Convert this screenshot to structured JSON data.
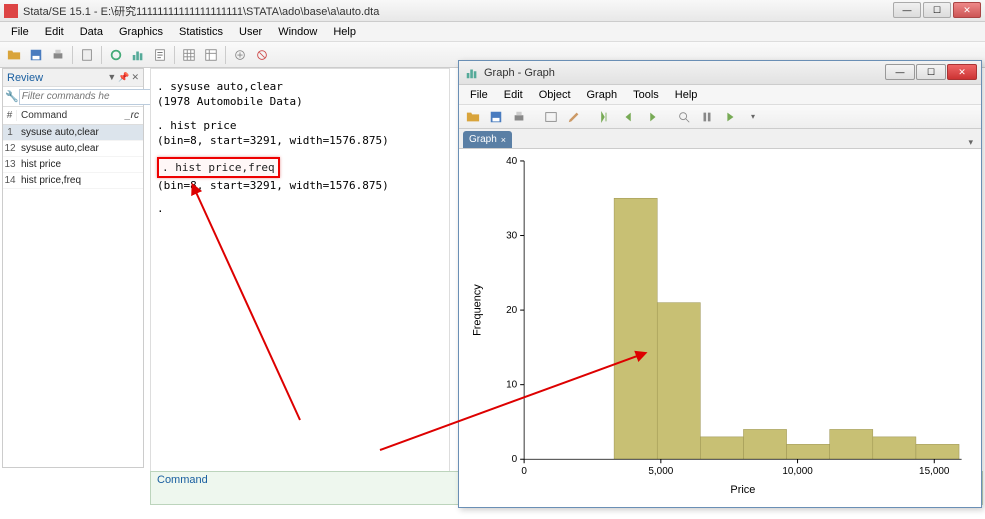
{
  "window": {
    "title": "Stata/SE 15.1 - E:\\研究11111111111111111111\\STATA\\ado\\base\\a\\auto.dta"
  },
  "menu": {
    "items": [
      "File",
      "Edit",
      "Data",
      "Graphics",
      "Statistics",
      "User",
      "Window",
      "Help"
    ]
  },
  "review": {
    "title": "Review",
    "filter_placeholder": "Filter commands he",
    "col_num": "#",
    "col_cmd": "Command",
    "col_rc": "_rc",
    "rows": [
      {
        "n": "1",
        "cmd": "sysuse auto,clear",
        "sel": true
      },
      {
        "n": "12",
        "cmd": "sysuse auto,clear",
        "sel": false
      },
      {
        "n": "13",
        "cmd": "hist price",
        "sel": false
      },
      {
        "n": "14",
        "cmd": "hist price,freq",
        "sel": false
      }
    ]
  },
  "results": {
    "line1": ". sysuse auto,clear",
    "line2": "(1978 Automobile Data)",
    "line3": ". hist price",
    "line4": "(bin=8, start=3291, width=1576.875)",
    "line5_cmd": ". hist price,freq",
    "line6": "(bin=8, start=3291, width=1576.875)",
    "line7": "."
  },
  "command_label": "Command",
  "graph_window": {
    "title": "Graph - Graph",
    "menu": [
      "File",
      "Edit",
      "Object",
      "Graph",
      "Tools",
      "Help"
    ],
    "tab_label": "Graph",
    "tab_close": "×"
  },
  "chart_data": {
    "type": "bar",
    "title": "",
    "xlabel": "Price",
    "ylabel": "Frequency",
    "x_ticks": [
      0,
      5000,
      10000,
      15000
    ],
    "y_ticks": [
      0,
      10,
      20,
      30,
      40
    ],
    "x_tick_labels": [
      "0",
      "5,000",
      "10,000",
      "15,000"
    ],
    "y_tick_labels": [
      "0",
      "10",
      "20",
      "30",
      "40"
    ],
    "xlim": [
      0,
      16000
    ],
    "ylim": [
      0,
      40
    ],
    "bin_start": 3291,
    "bin_width": 1576.875,
    "values": [
      35,
      21,
      3,
      4,
      2,
      4,
      3,
      2
    ]
  }
}
